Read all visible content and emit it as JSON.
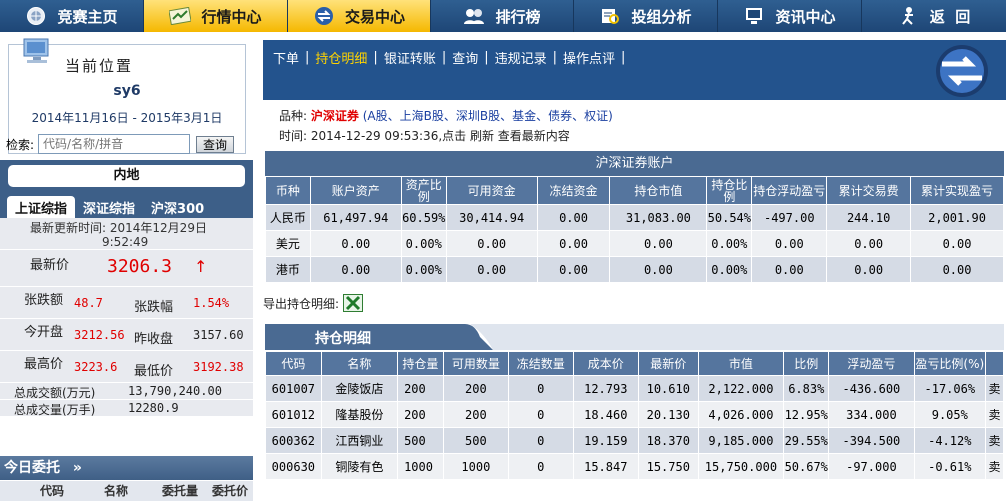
{
  "topnav": [
    {
      "label": "竞赛主页",
      "icon": "home-globe-icon"
    },
    {
      "label": "行情中心",
      "icon": "chart-icon",
      "active": true
    },
    {
      "label": "交易中心",
      "icon": "exchange-arrows-icon",
      "active": true
    },
    {
      "label": "排行榜",
      "icon": "users-icon"
    },
    {
      "label": "投组分析",
      "icon": "analysis-icon"
    },
    {
      "label": "资讯中心",
      "icon": "computer-icon"
    },
    {
      "label": "返  回",
      "icon": "person-running-icon"
    }
  ],
  "position": {
    "title": "当前位置",
    "user": "sy6",
    "date_range": "2014年11月16日 - 2015年3月1日"
  },
  "search": {
    "label": "检索:",
    "placeholder": "代码/名称/拼音",
    "button": "查询"
  },
  "market": {
    "tab_label": "内地",
    "index_tabs": [
      "上证综指",
      "深证综指",
      "沪深300"
    ],
    "update_label": "最新更新时间:",
    "update_date": "2014年12月29日",
    "update_time": "9:52:49",
    "latest_label": "最新价",
    "latest_value": "3206.3",
    "change_label": "张跌额",
    "change_value": "48.7",
    "change_pct_label": "张跌幅",
    "change_pct_value": "1.54%",
    "open_label": "今开盘",
    "open_value": "3212.56",
    "prev_close_label": "昨收盘",
    "prev_close_value": "3157.60",
    "high_label": "最高价",
    "high_value": "3223.6",
    "low_label": "最低价",
    "low_value": "3192.38",
    "turnover_label": "总成交额(万元)",
    "turnover_value": "13,790,240.00",
    "volume_label": "总成交量(万手)",
    "volume_value": "12280.9"
  },
  "entrust": {
    "title": "今日委托",
    "columns": [
      "代码",
      "名称",
      "委托量",
      "委托价"
    ]
  },
  "subnav": {
    "links": [
      "下单",
      "持仓明细",
      "银证转账",
      "查询",
      "违规记录",
      "操作点评"
    ],
    "active_index": 1
  },
  "info": {
    "variety_label": "品种:",
    "variety_value": "沪深证券",
    "variety_detail": "(A股、上海B股、深圳B股、基金、债券、权证)",
    "time_label": "时间:",
    "time_value": "2014-12-29 09:53:36",
    "time_suffix": ",点击 刷新 查看最新内容"
  },
  "account": {
    "title": "沪深证券账户",
    "headers": [
      "币种",
      "账户资产",
      "资产比例",
      "可用资金",
      "冻结资金",
      "持仓市值",
      "持仓比例",
      "持仓浮动盈亏",
      "累计交易费",
      "累计实现盈亏"
    ],
    "rows": [
      [
        "人民币",
        "61,497.94",
        "60.59%",
        "30,414.94",
        "0.00",
        "31,083.00",
        "50.54%",
        "-497.00",
        "244.10",
        "2,001.90"
      ],
      [
        "美元",
        "0.00",
        "0.00%",
        "0.00",
        "0.00",
        "0.00",
        "0.00%",
        "0.00",
        "0.00",
        "0.00"
      ],
      [
        "港币",
        "0.00",
        "0.00%",
        "0.00",
        "0.00",
        "0.00",
        "0.00%",
        "0.00",
        "0.00",
        "0.00"
      ]
    ]
  },
  "export_label": "导出持仓明细:",
  "holdings": {
    "title": "持仓明细",
    "headers": [
      "代码",
      "名称",
      "持仓量",
      "可用数量",
      "冻结数量",
      "成本价",
      "最新价",
      "市值",
      "比例",
      "浮动盈亏",
      "盈亏比例(%)",
      ""
    ],
    "rows": [
      [
        "601007",
        "金陵饭店",
        "200",
        "200",
        "0",
        "12.793",
        "10.610",
        "2,122.000",
        "6.83%",
        "-436.600",
        "-17.06%",
        "卖"
      ],
      [
        "601012",
        "隆基股份",
        "200",
        "200",
        "0",
        "18.460",
        "20.130",
        "4,026.000",
        "12.95%",
        "334.000",
        "9.05%",
        "卖"
      ],
      [
        "600362",
        "江西铜业",
        "500",
        "500",
        "0",
        "19.159",
        "18.370",
        "9,185.000",
        "29.55%",
        "-394.500",
        "-4.12%",
        "卖"
      ],
      [
        "000630",
        "铜陵有色",
        "1000",
        "1000",
        "0",
        "15.847",
        "15.750",
        "15,750.000",
        "50.67%",
        "-97.000",
        "-0.61%",
        "卖"
      ]
    ]
  }
}
